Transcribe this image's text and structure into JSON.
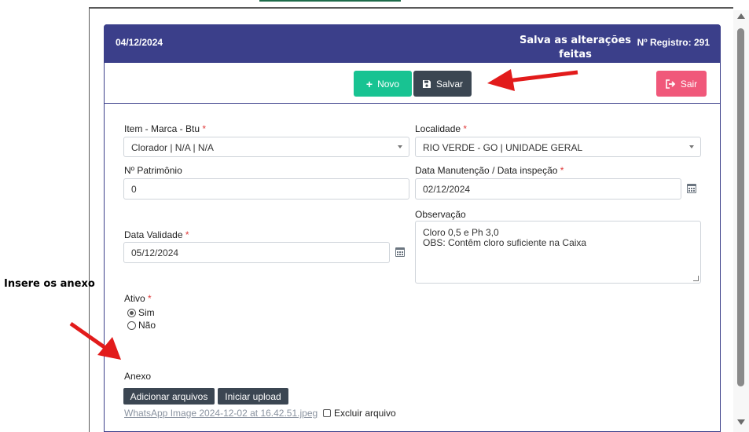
{
  "header": {
    "date": "04/12/2024",
    "registro_label": "Nº Registro:",
    "registro_value": "291"
  },
  "toolbar": {
    "novo_label": "Novo",
    "salvar_label": "Salvar",
    "sair_label": "Sair"
  },
  "form": {
    "item": {
      "label": "Item - Marca - Btu",
      "required_mark": "*",
      "value": "Clorador | N/A | N/A"
    },
    "localidade": {
      "label": "Localidade",
      "required_mark": "*",
      "value": "RIO VERDE - GO | UNIDADE GERAL"
    },
    "patrimonio": {
      "label": "Nº Patrimônio",
      "value": "0"
    },
    "data_manutencao": {
      "label": "Data Manutenção / Data inspeção",
      "required_mark": "*",
      "value": "02/12/2024"
    },
    "observacao": {
      "label": "Observação",
      "line1": "Cloro 0,5 e Ph 3,0",
      "line2": "OBS: Contêm cloro suficiente na Caixa"
    },
    "data_validade": {
      "label": "Data Validade",
      "required_mark": "*",
      "value": "05/12/2024"
    },
    "ativo": {
      "label": "Ativo",
      "required_mark": "*",
      "options": [
        "Sim",
        "Não"
      ],
      "selected": "Sim"
    },
    "anexo": {
      "label": "Anexo",
      "add_button": "Adicionar arquivos",
      "upload_button": "Iniciar upload",
      "file_name": "WhatsApp Image 2024-12-02 at 16.42.51.jpeg",
      "delete_label": "Excluir arquivo"
    }
  },
  "annotations": {
    "save_note": "Salva as alterações feitas",
    "attach_note": "Insere os anexo"
  },
  "colors": {
    "header_bg": "#3b3f8a",
    "novo": "#18c392",
    "salvar": "#3b4652",
    "sair": "#f0587a",
    "arrow": "#e21b1b"
  },
  "icons": [
    "plus-icon",
    "floppy-disk-icon",
    "sign-out-icon",
    "calendar-icon",
    "scroll-up-icon",
    "scroll-down-icon"
  ]
}
